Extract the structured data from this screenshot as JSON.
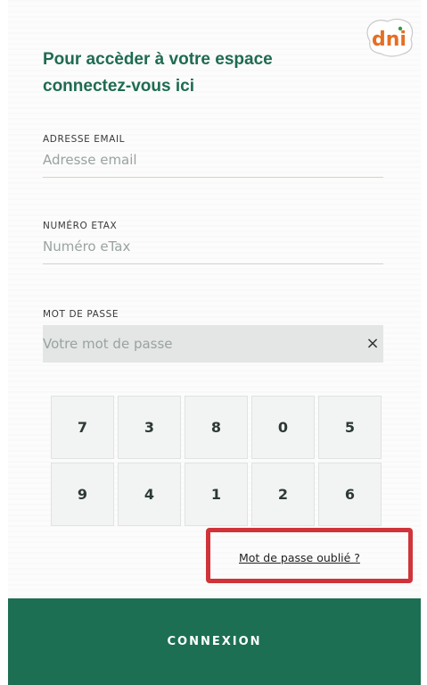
{
  "logo": {
    "text": "dni",
    "icon": "dni-logo"
  },
  "title": "Pour accèder à votre espace connectez-vous ici",
  "fields": {
    "email": {
      "label": "ADRESSE EMAIL",
      "placeholder": "Adresse email",
      "value": ""
    },
    "etax": {
      "label": "NUMÉRO ETAX",
      "placeholder": "Numéro eTax",
      "value": ""
    },
    "password": {
      "label": "MOT DE PASSE",
      "placeholder": "Votre mot de passe",
      "value": "",
      "clear_symbol": "×"
    }
  },
  "keypad": {
    "row1": [
      "7",
      "3",
      "8",
      "0",
      "5"
    ],
    "row2": [
      "9",
      "4",
      "1",
      "2",
      "6"
    ]
  },
  "forgot_password": "Mot de passe oublié ?",
  "connexion_label": "CONNEXION",
  "colors": {
    "brand_green": "#1c6f52",
    "highlight_red": "#d0343a"
  }
}
